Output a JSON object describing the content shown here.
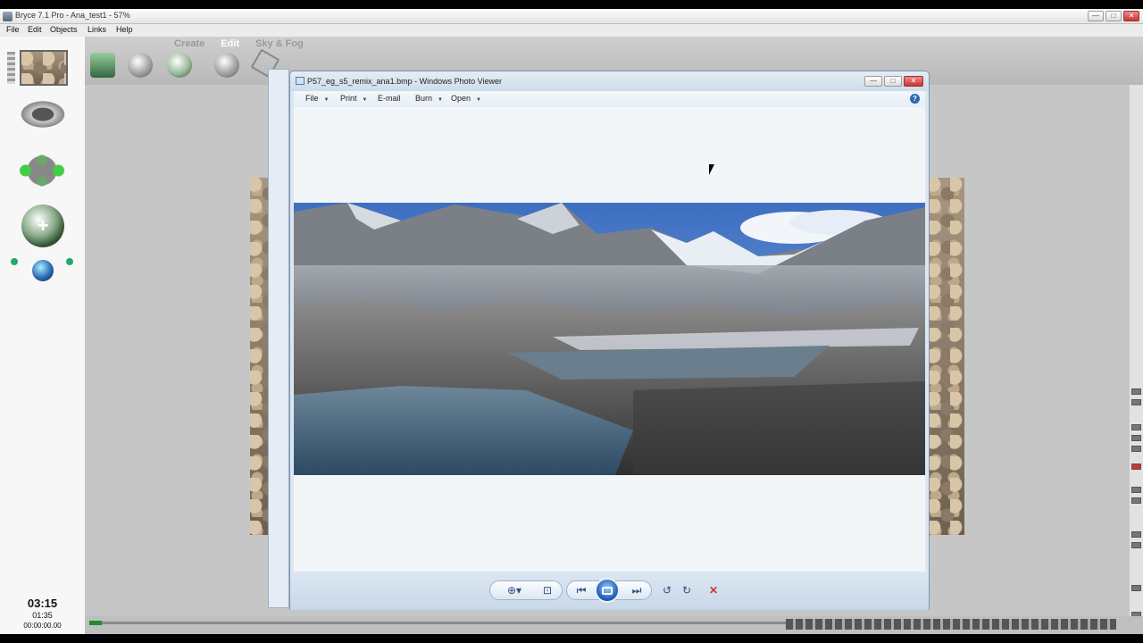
{
  "bryce": {
    "title": "Bryce 7.1  Pro - Ana_test1 - 57%",
    "menu": [
      "File",
      "Edit",
      "Objects",
      "Links",
      "Help"
    ],
    "tabs": [
      "Create",
      "Edit",
      "Sky & Fog"
    ],
    "clock": {
      "main": "03:15",
      "sub": "01:35",
      "timecode": "00:00:00.00"
    }
  },
  "photo_viewer": {
    "title": "P57_eg_s5_remix_ana1.bmp - Windows Photo Viewer",
    "menu": [
      "File",
      "Print",
      "E-mail",
      "Burn",
      "Open"
    ],
    "help_glyph": "?"
  },
  "colors": {
    "viewer_bg": "#f3f6f9",
    "viewer_chrome": "#dbe6f1",
    "close_red": "#c33333",
    "accent_blue": "#1e5fb4"
  }
}
